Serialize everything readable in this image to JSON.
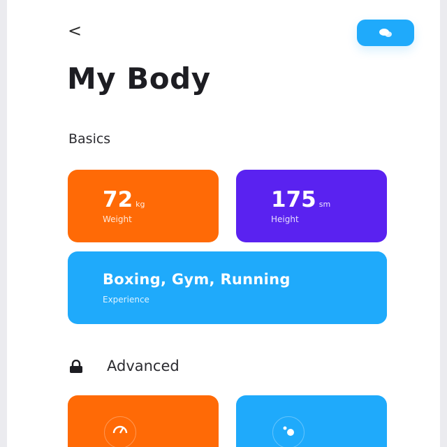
{
  "nav": {
    "back_label": "<"
  },
  "icons": {
    "action": "chat-icon",
    "lock": "lock-icon",
    "bottom_left": "gauge-icon",
    "bottom_right": "molecule-icon"
  },
  "page": {
    "title": "My Body"
  },
  "basics": {
    "heading": "Basics",
    "weight": {
      "value": "72",
      "unit": "kg",
      "label": "Weight"
    },
    "height": {
      "value": "175",
      "unit": "sm",
      "label": "Height"
    },
    "experience": {
      "value": "Boxing, Gym, Running",
      "label": "Experience"
    }
  },
  "advanced": {
    "heading": "Advanced"
  },
  "colors": {
    "orange": "#ff6a06",
    "purple": "#5a22f0",
    "blue": "#1faafb",
    "background": "#ffffff"
  }
}
